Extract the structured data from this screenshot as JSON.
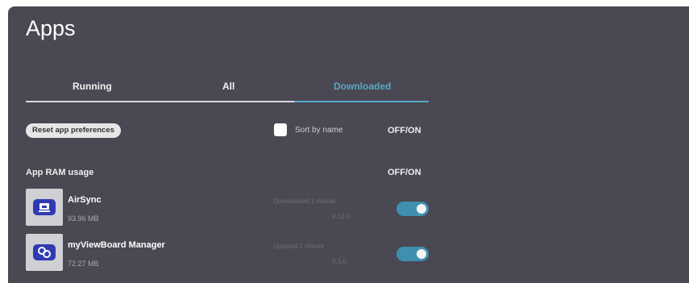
{
  "header": {
    "title": "Apps"
  },
  "tabs": [
    {
      "label": "Running"
    },
    {
      "label": "All"
    },
    {
      "label": "Downloaded"
    }
  ],
  "toolbar": {
    "reset_label": "Reset app preferences",
    "sort_label": "Sort by name",
    "offon_label": "OFF/ON"
  },
  "ram": {
    "label": "App RAM usage",
    "offon_label": "OFF/ON"
  },
  "apps": [
    {
      "name": "AirSync",
      "size": "93.96 MB",
      "meta1": "Downloaded 1 minute",
      "meta2": "9.10.0",
      "enabled": true,
      "icon": "cast-icon"
    },
    {
      "name": "myViewBoard Manager",
      "size": "72.27 MB",
      "meta1": "Updated 1 minute",
      "meta2": "9.3.0",
      "enabled": true,
      "icon": "link-icon"
    }
  ],
  "colors": {
    "background": "#4a4852",
    "accent": "#57a8c8",
    "toggle": "#3f8fae"
  }
}
